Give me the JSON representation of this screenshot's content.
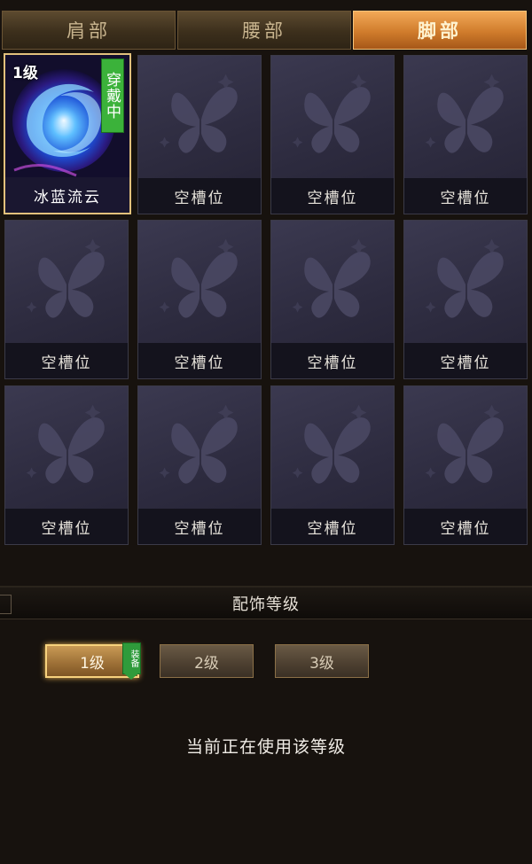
{
  "tabs": [
    {
      "label": "肩部",
      "active": false
    },
    {
      "label": "腰部",
      "active": false
    },
    {
      "label": "脚部",
      "active": true
    }
  ],
  "grid": {
    "equipped_item": {
      "name": "冰蓝流云",
      "level_tag": "1级",
      "status_badge": "穿戴中",
      "icon": "blue-vortex-icon"
    },
    "empty_label": "空槽位",
    "empty_icon": "butterfly-icon",
    "slots": [
      {
        "label": "冰蓝流云"
      },
      {
        "label": "空槽位"
      },
      {
        "label": "空槽位"
      },
      {
        "label": "空槽位"
      },
      {
        "label": "空槽位"
      },
      {
        "label": "空槽位"
      },
      {
        "label": "空槽位"
      },
      {
        "label": "空槽位"
      },
      {
        "label": "空槽位"
      },
      {
        "label": "空槽位"
      },
      {
        "label": "空槽位"
      },
      {
        "label": "空槽位"
      }
    ]
  },
  "level_section": {
    "title": "配饰等级",
    "levels": [
      {
        "label": "1级",
        "active": true
      },
      {
        "label": "2级",
        "active": false
      },
      {
        "label": "3级",
        "active": false
      }
    ],
    "equip_badge": "装备",
    "status_text": "当前正在使用该等级"
  },
  "colors": {
    "tab_active": "#d07c2c",
    "equipped_badge": "#3bb23a",
    "slot_bg": "#2d2b3f",
    "gold_border": "#e2c17c"
  }
}
